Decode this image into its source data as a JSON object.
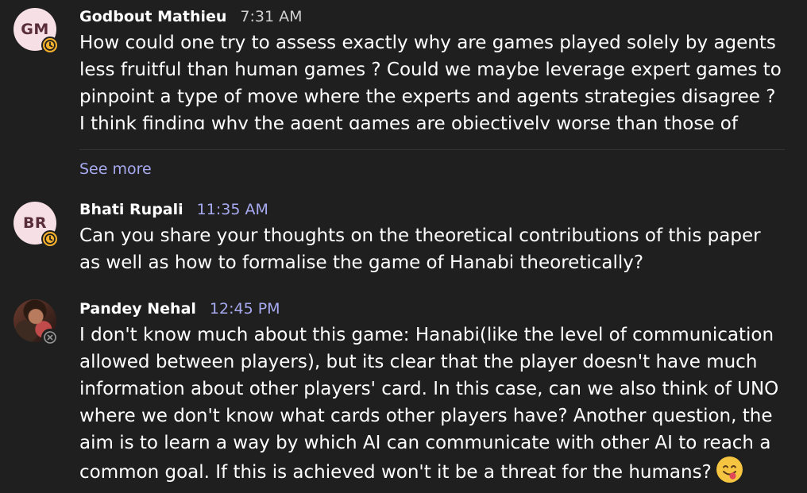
{
  "messages": [
    {
      "author": "Godbout Mathieu",
      "initials": "GM",
      "time": "7:31 AM",
      "status": "away",
      "text": "How could one try to assess exactly why are games played solely by agents less fruitful than human games ? Could we maybe leverage expert games to pinpoint a type of move where the experts and agents strategies disagree ? I think finding why the agent games are objectively worse than those of experts could help guide further improvement",
      "see_more": "See more"
    },
    {
      "author": "Bhati Rupali",
      "initials": "BR",
      "time": "11:35 AM",
      "status": "away",
      "text": "Can you share your thoughts on the theoretical contributions of this paper as well as how to formalise the game of Hanabi theoretically?"
    },
    {
      "author": "Pandey Nehal",
      "time": "12:45 PM",
      "status": "offline",
      "text": "I don't know much about this game: Hanabi(like the level of communication allowed between players), but its clear that the player doesn't have much information about other players' card. In this case, can we also think of UNO where we don't know what cards other players have? Another question, the aim is to learn a way by which AI can communicate with other AI to reach a common goal. If this is achieved won't it be a threat for the humans?",
      "emoji": "face-savoring-food"
    }
  ],
  "colors": {
    "background": "#1f1f1f",
    "accent": "#a7aaf0",
    "away_status": "#f8b12c"
  }
}
